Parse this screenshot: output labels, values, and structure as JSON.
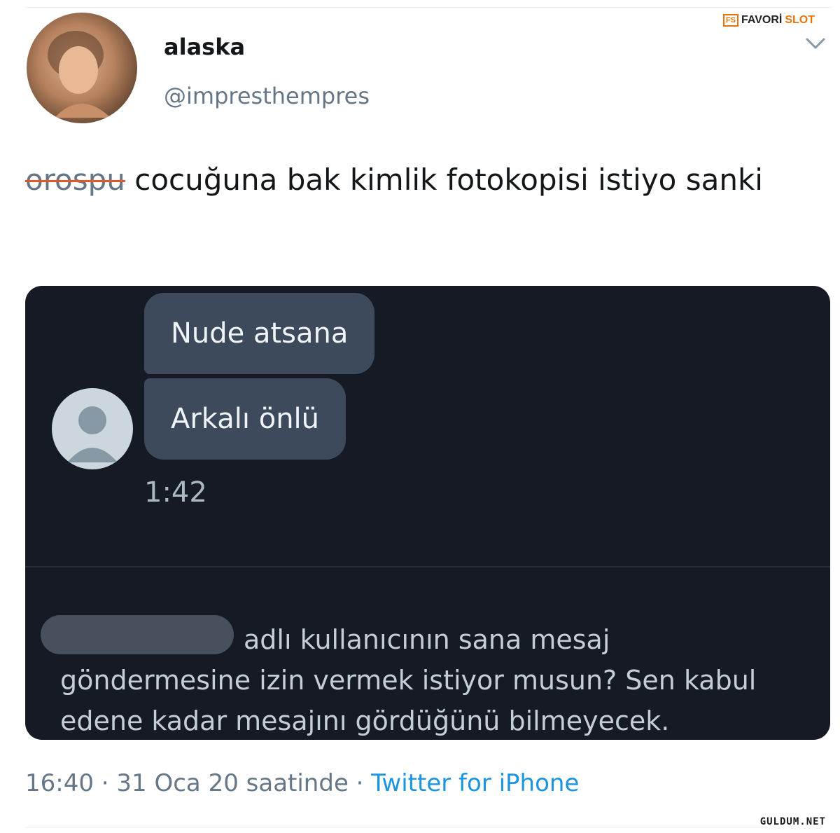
{
  "user": {
    "display_name": "alaska",
    "handle": "@impresthempres"
  },
  "brand": {
    "logo_box": "FS",
    "logo_part1": "FAVORİ",
    "logo_part2": "SLOT",
    "accent_color": "#e8740c"
  },
  "tweet": {
    "struck_word": "orospu",
    "text": " cocuğuna bak kimlik fotokopisi istiyo sanki",
    "timestamp": "16:40 · 31 Oca 20 saatinde · ",
    "source": "Twitter for iPhone"
  },
  "dm": {
    "messages": [
      {
        "text": "Nude atsana"
      },
      {
        "text": "Arkalı önlü"
      }
    ],
    "time": "1:42",
    "notice": "adlı kullanıcının sana mesaj göndermesine izin vermek istiyor musun? Sen kabul edene kadar mesajını gördüğünü bilmeyecek."
  },
  "watermark": "GULDUM.NET",
  "colors": {
    "dm_background": "#151a25",
    "bubble": "#3d4a5b",
    "link": "#1b95e0"
  },
  "icons": {
    "menu": "chevron-down-icon",
    "dm_avatar": "default-avatar-icon"
  }
}
